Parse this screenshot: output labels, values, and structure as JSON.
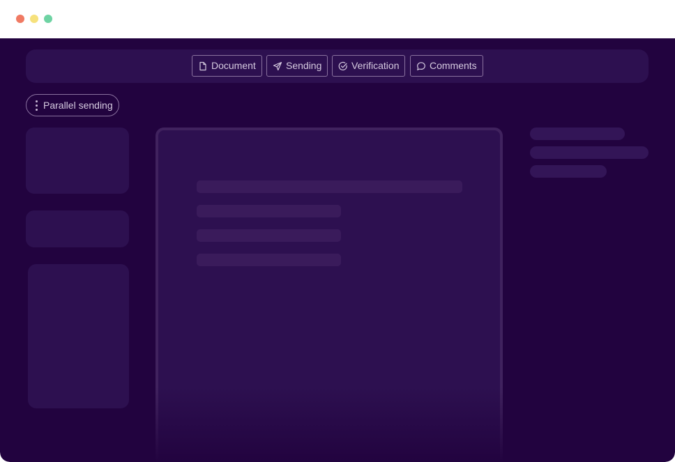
{
  "window": {
    "controls": [
      "close",
      "minimize",
      "maximize"
    ],
    "colors": {
      "close": "#f07a63",
      "minimize": "#f6e17c",
      "maximize": "#6ed3a3"
    }
  },
  "toolbar": {
    "tabs": [
      {
        "label": "Document",
        "icon": "document-icon"
      },
      {
        "label": "Sending",
        "icon": "send-icon"
      },
      {
        "label": "Verification",
        "icon": "check-circle-icon"
      },
      {
        "label": "Comments",
        "icon": "comment-icon"
      }
    ]
  },
  "mode": {
    "label": "Parallel sending",
    "icon": "kebab-icon"
  },
  "theme": {
    "background": "#22033f",
    "panel": "#2d1050",
    "border": "#8a729f",
    "text": "#d6cbe0"
  }
}
